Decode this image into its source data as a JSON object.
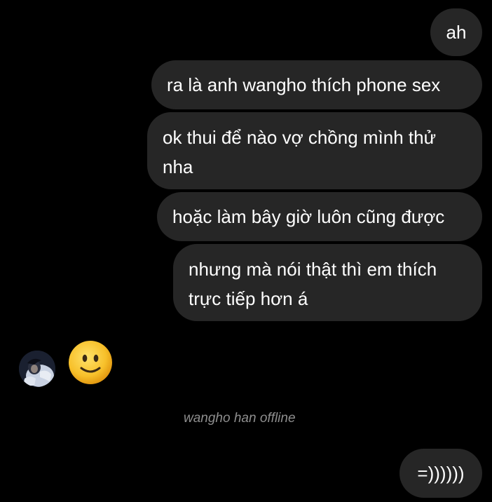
{
  "messages": [
    {
      "text": "ah"
    },
    {
      "text": "ra là anh wangho thích phone sex"
    },
    {
      "text": "ok thui để nào vợ chồng mình thử nha"
    },
    {
      "text": "hoặc làm bây giờ luôn cũng được"
    },
    {
      "text": "nhưng mà nói thật thì em thích trực tiếp hơn á"
    }
  ],
  "reply": {
    "avatar_icon": "user-avatar-icon",
    "emoji_icon": "slightly-smiling-face-icon"
  },
  "status": {
    "text": "wangho han offline"
  },
  "last_message": {
    "text": "=))))))"
  },
  "colors": {
    "background": "#000000",
    "bubble": "#262626",
    "status_text": "#8e8e8e",
    "emoji_face": "#f7c02a"
  }
}
